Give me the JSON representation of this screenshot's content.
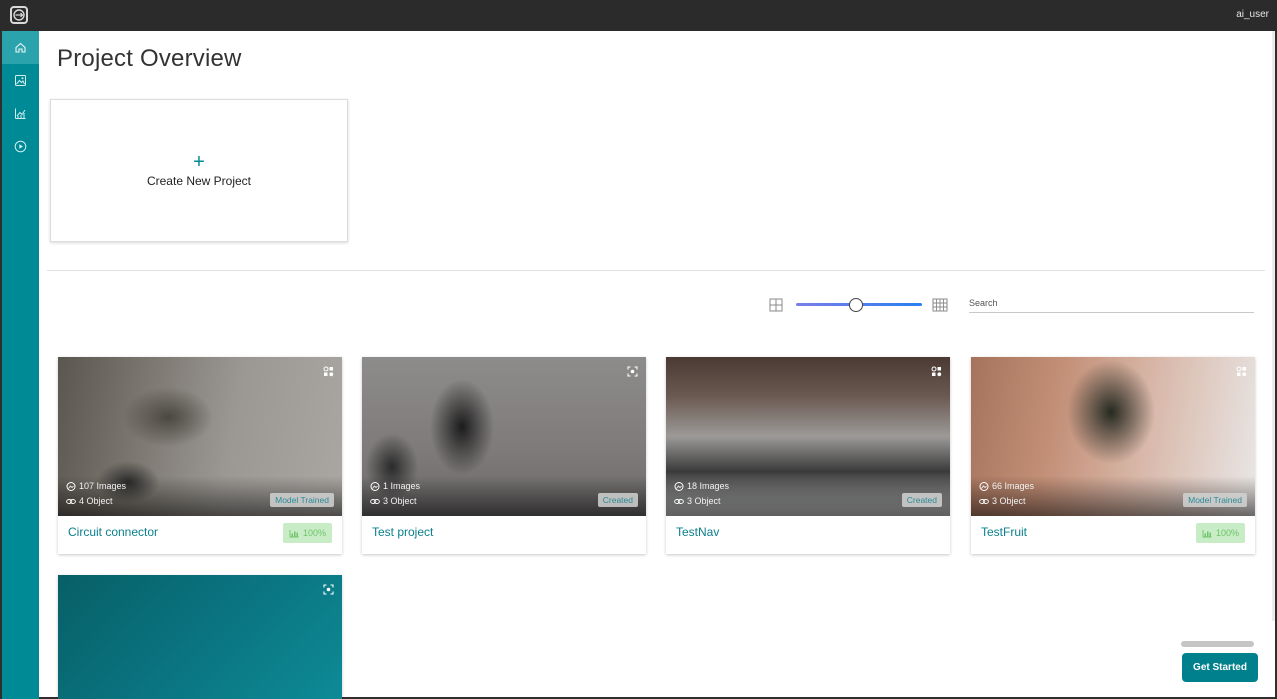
{
  "header": {
    "user": "ai_user"
  },
  "sidebar": {
    "items": [
      {
        "icon": "home-icon",
        "active": true
      },
      {
        "icon": "image-icon",
        "active": false
      },
      {
        "icon": "analytics-icon",
        "active": false
      },
      {
        "icon": "play-icon",
        "active": false
      }
    ]
  },
  "page": {
    "title": "Project Overview"
  },
  "create": {
    "plus": "+",
    "label": "Create New Project"
  },
  "toolbar": {
    "search_placeholder": "Search",
    "slider_value": 0.47
  },
  "projects": [
    {
      "title": "Circuit connector",
      "images": "107 Images",
      "objects": "4 Object",
      "status": "Model Trained",
      "accuracy": "100%",
      "thumb_icon": "objects-icon"
    },
    {
      "title": "Test project",
      "images": "1 Images",
      "objects": "3 Object",
      "status": "Created",
      "thumb_icon": "focus-icon"
    },
    {
      "title": "TestNav",
      "images": "18 Images",
      "objects": "3 Object",
      "status": "Created",
      "thumb_icon": "objects-icon"
    },
    {
      "title": "TestFruit",
      "images": "66 Images",
      "objects": "3 Object",
      "status": "Model Trained",
      "accuracy": "100%",
      "thumb_icon": "objects-icon"
    },
    {
      "thumb_icon": "focus-icon"
    }
  ],
  "footer": {
    "get_started": "Get Started"
  },
  "colors": {
    "accent": "#008a96",
    "topbar": "#2b2b2b",
    "success_bg": "#c8ecc6",
    "success_fg": "#6fc36a"
  }
}
